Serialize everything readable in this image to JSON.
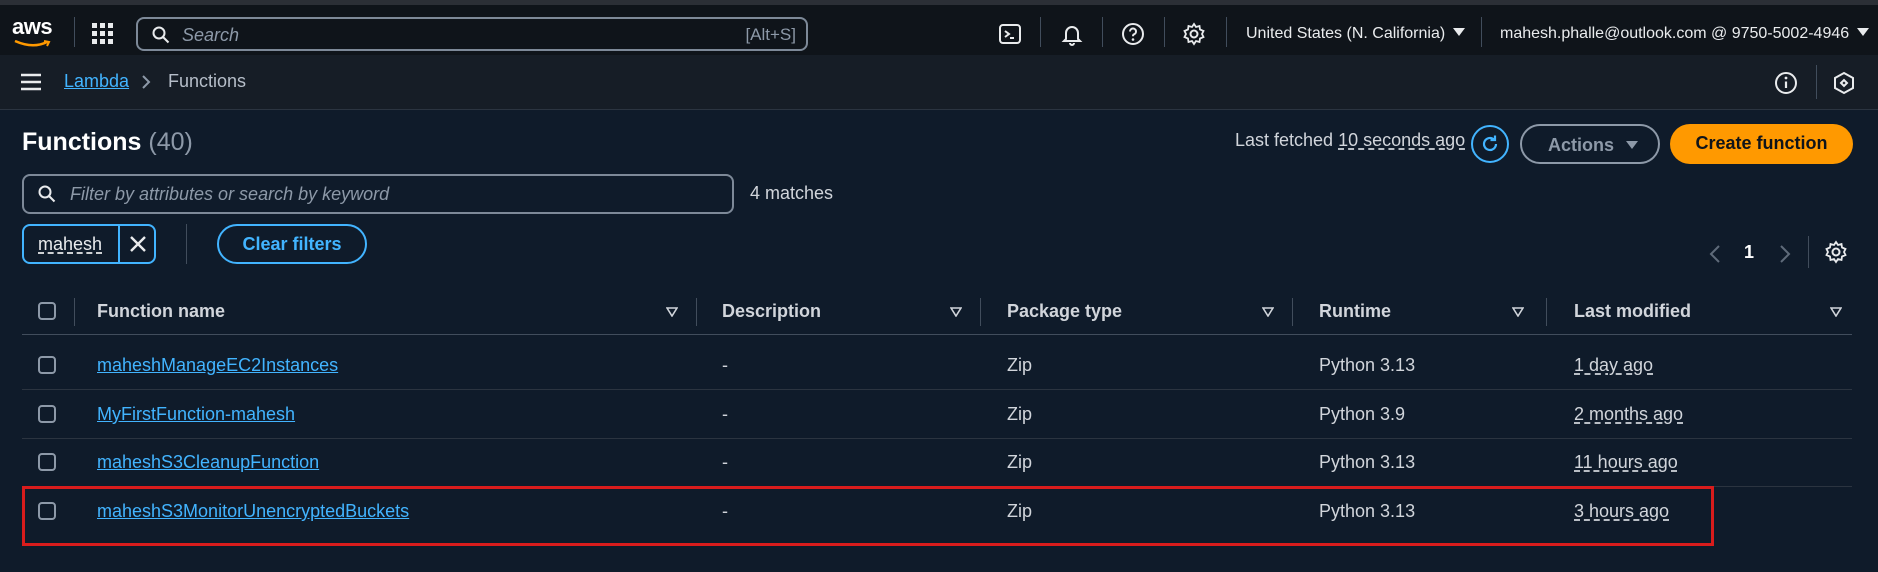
{
  "topnav": {
    "logo_text": "aws",
    "search_placeholder": "Search",
    "search_shortcut": "[Alt+S]",
    "region": "United States (N. California)",
    "account": "mahesh.phalle@outlook.com @ 9750-5002-4946"
  },
  "breadcrumb": {
    "service": "Lambda",
    "current": "Functions"
  },
  "header": {
    "title": "Functions",
    "count": "(40)",
    "last_fetched_label": "Last fetched",
    "last_fetched_value": "10 seconds ago",
    "actions_label": "Actions",
    "create_label": "Create function"
  },
  "filter": {
    "placeholder": "Filter by attributes or search by keyword",
    "matches": "4 matches",
    "token": "mahesh",
    "clear_label": "Clear filters"
  },
  "pagination": {
    "page": "1"
  },
  "table": {
    "columns": [
      "Function name",
      "Description",
      "Package type",
      "Runtime",
      "Last modified"
    ],
    "rows": [
      {
        "name": "maheshManageEC2Instances",
        "description": "-",
        "package": "Zip",
        "runtime": "Python 3.13",
        "modified": "1 day ago"
      },
      {
        "name": "MyFirstFunction-mahesh",
        "description": "-",
        "package": "Zip",
        "runtime": "Python 3.9",
        "modified": "2 months ago"
      },
      {
        "name": "maheshS3CleanupFunction",
        "description": "-",
        "package": "Zip",
        "runtime": "Python 3.13",
        "modified": "11 hours ago"
      },
      {
        "name": "maheshS3MonitorUnencryptedBuckets",
        "description": "-",
        "package": "Zip",
        "runtime": "Python 3.13",
        "modified": "3 hours ago"
      }
    ]
  },
  "colors": {
    "accent_link": "#42b4ff",
    "primary_button": "#ff9900",
    "highlight_box": "#d91c1c",
    "background": "#0f1b2a"
  }
}
